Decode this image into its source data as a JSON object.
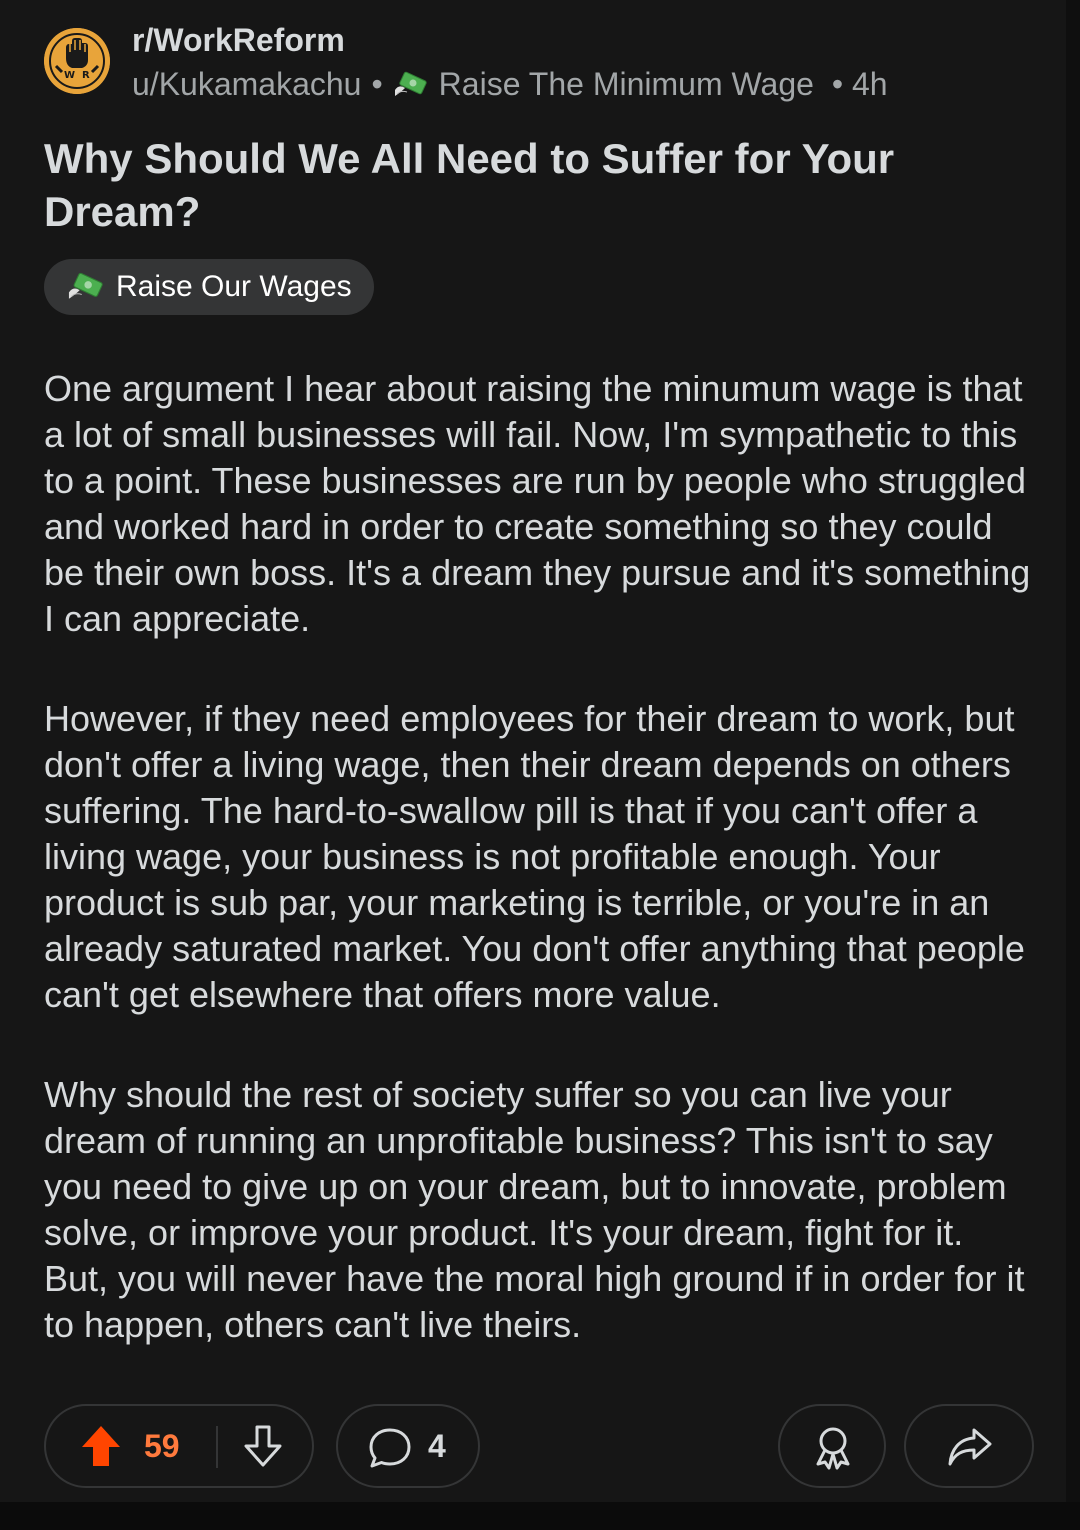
{
  "post": {
    "subreddit": "r/WorkReform",
    "author": "u/Kukamakachu",
    "meta_separator": "•",
    "author_flair": "Raise The Minimum Wage",
    "age": "• 4h",
    "title": "Why Should We All Need to Suffer for Your Dream?",
    "flair": "Raise Our Wages",
    "paragraphs": [
      "One argument I hear about raising the minumum wage is that a lot of small businesses will fail. Now, I'm sympathetic to this to a point. These businesses are run by people who struggled and worked hard in order to create something so they could be their own boss. It's a dream they pursue and it's something I can appreciate.",
      "However, if they need employees for their dream to work, but don't offer a living wage, then their dream depends on others suffering. The hard-to-swallow pill is that if you can't offer a living wage, your business is not profitable enough. Your product is sub par, your marketing is terrible, or you're in an already saturated market. You don't offer anything that people can't get elsewhere that offers more value.",
      "Why should the rest of society suffer so you can live your dream of running an unprofitable business? This isn't to say you need to give up on your dream, but to innovate, problem solve, or improve your product. It's your dream, fight for it. But, you will never have the moral high ground if in order for it to happen, others can't live theirs."
    ]
  },
  "actions": {
    "score": "59",
    "comments": "4"
  },
  "icons": {
    "avatar": "workreform-fist-logo",
    "flair_icon": "money-with-wings-icon",
    "upvote": "upvote-arrow-icon",
    "downvote": "downvote-arrow-icon",
    "comment": "comment-bubble-icon",
    "award": "award-icon",
    "share": "share-arrow-icon"
  },
  "colors": {
    "background": "#161616",
    "text": "#d7dadc",
    "muted": "#a2a6a8",
    "upvoted": "#ff4500",
    "score": "#ff7a3d",
    "flair_bg": "#343536",
    "avatar_bg": "#e8a43a"
  }
}
